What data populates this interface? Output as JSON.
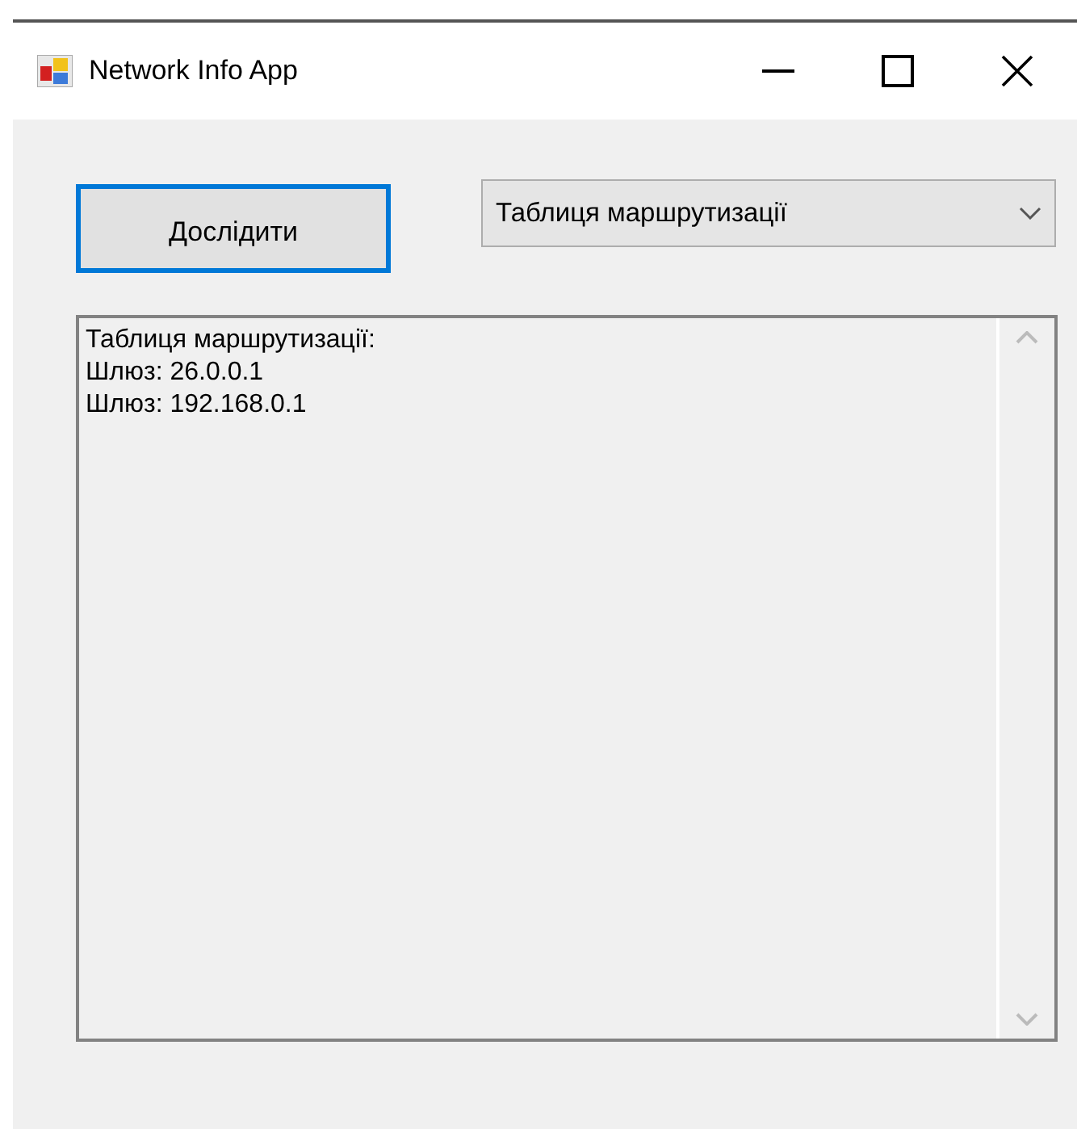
{
  "window": {
    "title": "Network Info App"
  },
  "explore_button": {
    "label": "Дослідити"
  },
  "dropdown": {
    "value": "Таблиця маршрутизації"
  },
  "output_box": {
    "lines": [
      "Таблиця маршрутизації:",
      "Шлюз: 26.0.0.1",
      "Шлюз: 192.168.0.1"
    ]
  }
}
